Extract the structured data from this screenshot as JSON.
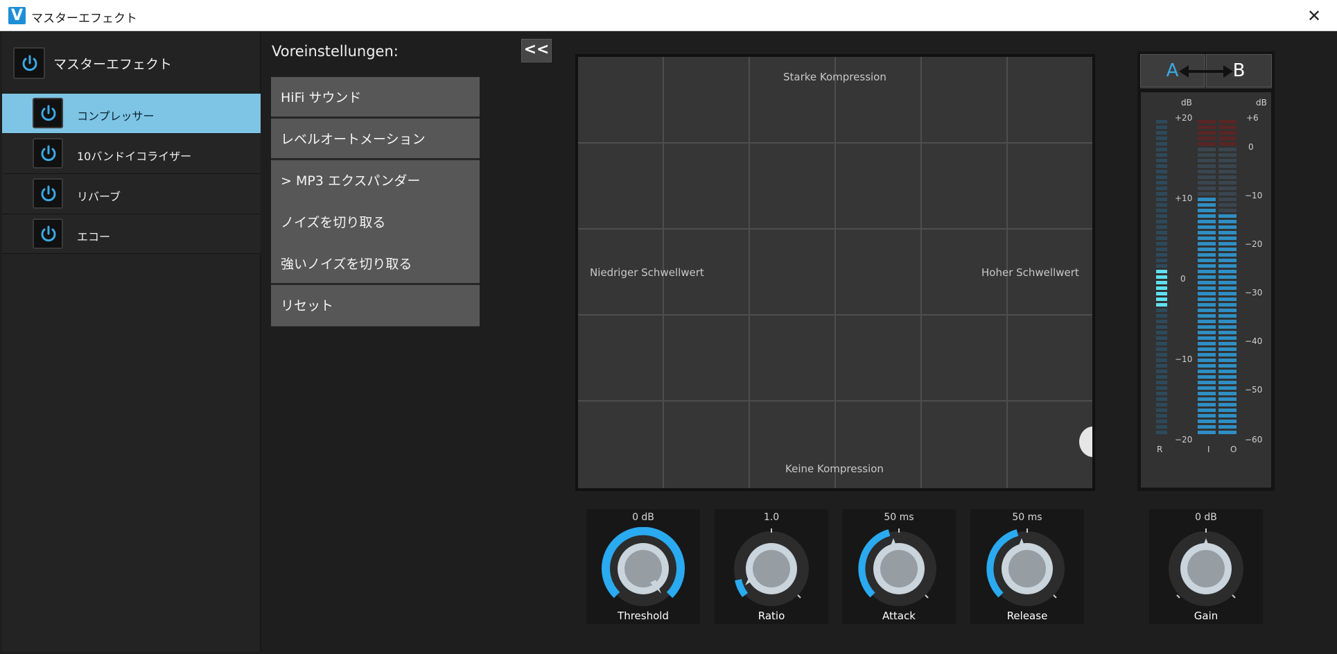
{
  "window": {
    "title": "マスターエフェクト",
    "close_glyph": "✕",
    "logo_letter": "V"
  },
  "left_panel": {
    "master_label": "マスターエフェクト",
    "effects": [
      {
        "label": "コンプレッサー",
        "active": true
      },
      {
        "label": "10バンドイコライザー",
        "active": false
      },
      {
        "label": "リバーブ",
        "active": false
      },
      {
        "label": "エコー",
        "active": false
      }
    ]
  },
  "presets": {
    "title": "Voreinstellungen:",
    "collapse_glyph": "<<",
    "items": [
      {
        "label": "HiFi サウンド"
      },
      {
        "label": "レベルオートメーション"
      },
      {
        "label": "> MP3 エクスパンダー"
      },
      {
        "label": "ノイズを切り取る"
      },
      {
        "label": "強いノイズを切り取る"
      },
      {
        "label": "リセット"
      }
    ]
  },
  "graph": {
    "top_label": "Starke Kompression",
    "bottom_label": "Keine Kompression",
    "left_label": "Niedriger Schwellwert",
    "right_label": "Hoher Schwellwert"
  },
  "meter": {
    "a_label": "A",
    "b_label": "B",
    "db_left": "dB",
    "db_right": "dB",
    "left_scale": [
      "+20",
      "+10",
      "0",
      "−10",
      "−20"
    ],
    "right_scale": [
      "+6",
      "0",
      "−10",
      "−20",
      "−30",
      "−40",
      "−50",
      "−60"
    ],
    "channel_r": "R",
    "channel_i": "I",
    "channel_o": "O",
    "accent_color": "#3aaae4"
  },
  "knobs": [
    {
      "name": "Threshold",
      "value": "0 dB"
    },
    {
      "name": "Ratio",
      "value": "1.0"
    },
    {
      "name": "Attack",
      "value": "50 ms"
    },
    {
      "name": "Release",
      "value": "50 ms"
    },
    {
      "name": "Gain",
      "value": "0 dB"
    }
  ]
}
